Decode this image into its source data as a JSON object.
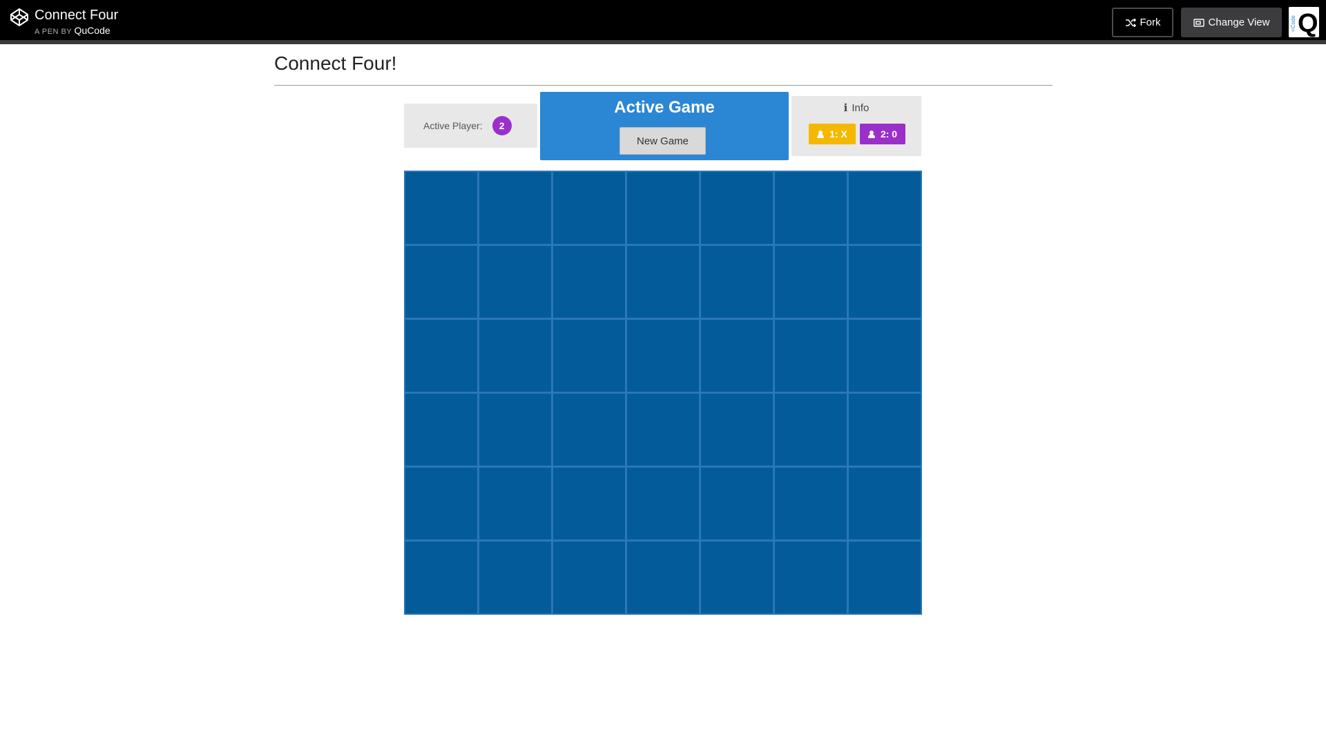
{
  "header": {
    "pen_title": "Connect Four",
    "pen_by": "A PEN BY",
    "author": "QuCode",
    "fork_label": "Fork",
    "change_view_label": "Change View",
    "avatar_letter": "Q",
    "avatar_side_text": "<Code"
  },
  "page": {
    "title": "Connect Four!"
  },
  "status": {
    "active_player_label": "Active Player:",
    "active_player": "2",
    "game_title": "Active Game",
    "new_game_label": "New Game",
    "info_label": "Info",
    "scores": [
      "1: X",
      "2: 0"
    ]
  },
  "board": {
    "columns": 7,
    "rows": 6
  },
  "colors": {
    "player1": "#f5b800",
    "player2": "#9b2fc9",
    "board_cell": "#045b99",
    "board_grid": "#2a78b8",
    "game_panel": "#2b87d3"
  }
}
